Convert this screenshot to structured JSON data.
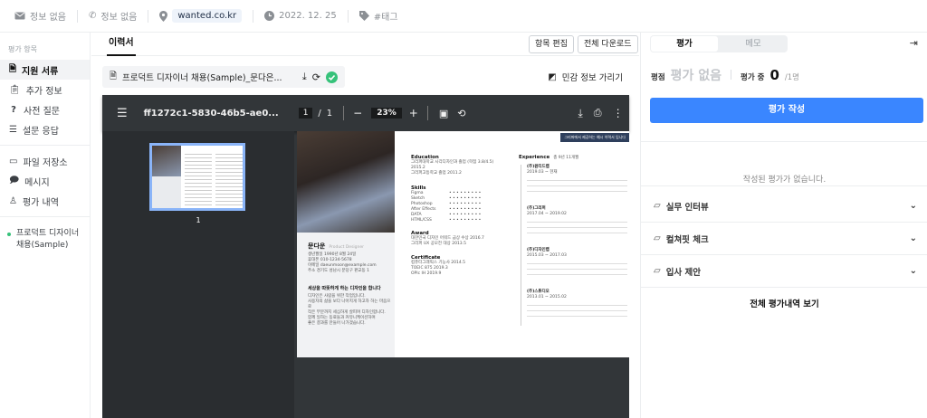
{
  "topbar": {
    "email": "정보 없음",
    "phone": "정보 없음",
    "website": "wanted.co.kr",
    "date": "2022. 12. 25",
    "tag": "#태그"
  },
  "sidebar": {
    "section_title": "평가 항목",
    "items": [
      {
        "label": "지원 서류",
        "icon": "document-icon",
        "active": true
      },
      {
        "label": "추가 정보",
        "icon": "clipboard-icon",
        "active": false
      },
      {
        "label": "사전 질문",
        "icon": "question-icon",
        "active": false
      },
      {
        "label": "설문 응답",
        "icon": "list-icon",
        "active": false
      }
    ],
    "items2": [
      {
        "label": "파일 저장소",
        "icon": "folder-icon"
      },
      {
        "label": "메시지",
        "icon": "chat-icon"
      },
      {
        "label": "평가 내역",
        "icon": "user-check-icon"
      }
    ],
    "job": "프로덕트 디자이너 채용(Sample)"
  },
  "main": {
    "tab": "이력서",
    "btn_item_edit": "항목 편집",
    "btn_download_all": "전체 다운로드",
    "file_name": "프로덕트 디자이너 채용(Sample)_문다은...",
    "privacy_label": "민감 정보 가리기"
  },
  "pdf": {
    "file_id": "ff1272c1-5830-46b5-ae0...",
    "page_current": "1",
    "page_sep": "/",
    "page_total": "1",
    "zoom": "23%",
    "thumb_page": "1",
    "resume": {
      "banner": "그리퍼에서 제공하는 예시 이력서 입니다",
      "name": "문다운",
      "role": "Product Designer",
      "info": [
        "생년월일   1990년 8월 24일",
        "휴대폰   010-1234-5678",
        "이메일   daeunmoon@example.com",
        "주소   경기도 성남시 분당구 판교동 1"
      ],
      "intro_title": "세상을 따뜻하게 하는 디자인을 합니다",
      "intro_lines": [
        "디자인은 사람을 위한 작업입니다.",
        "사용자의 삶을 보다 나아지게 하고자 하는 마음으로",
        "작은 부분까지 세심하게 살피며 디자인합니다.",
        "함께 일하는 동료들과 커뮤니케이션하며",
        "좋은 결과를 만들어 나가겠습니다."
      ],
      "education_title": "Education",
      "education": [
        "그리퍼대학교 시각디자인과 졸업 (학점 3.8/4.5)  2015.2",
        "그리퍼고등학교 졸업  2011.2"
      ],
      "skills_title": "Skills",
      "skills": [
        "Figma",
        "Sketch",
        "Photoshop",
        "After Effects",
        "DATA",
        "HTML/CSS"
      ],
      "award_title": "Award",
      "award": [
        "대한민국 디자인 어워드 금상 수상  2016.7",
        "그리퍼 UX 공모전 대상  2013.5"
      ],
      "cert_title": "Certificate",
      "cert": [
        "컴퓨터그래픽스 기능사  2014.5",
        "TOEIC 875  2019.3",
        "OPIc IH  2019.9"
      ],
      "experience_title": "Experience",
      "experience_sub": "총 9년 11개월",
      "experience": [
        {
          "company": "(주)원티드랩",
          "period": "2019.03 ~ 현재"
        },
        {
          "company": "(주)그리퍼",
          "period": "2017.04 ~ 2019.02"
        },
        {
          "company": "(주)디자인랩",
          "period": "2015.03 ~ 2017.03"
        },
        {
          "company": "(주)스튜디오",
          "period": "2013.01 ~ 2015.02"
        }
      ]
    }
  },
  "right": {
    "tab_eval": "평가",
    "tab_memo": "메모",
    "score_label": "평점",
    "score_value": "평가 없음",
    "evaluating_label": "평가 중",
    "evaluating_count": "0",
    "evaluating_total": "/1명",
    "write_button": "평가 작성",
    "empty_message": "작성된 평가가 없습니다.",
    "accordions": [
      "실무 인터뷰",
      "컬쳐핏 체크",
      "입사 제안"
    ],
    "view_all": "전체 평가내역 보기"
  }
}
